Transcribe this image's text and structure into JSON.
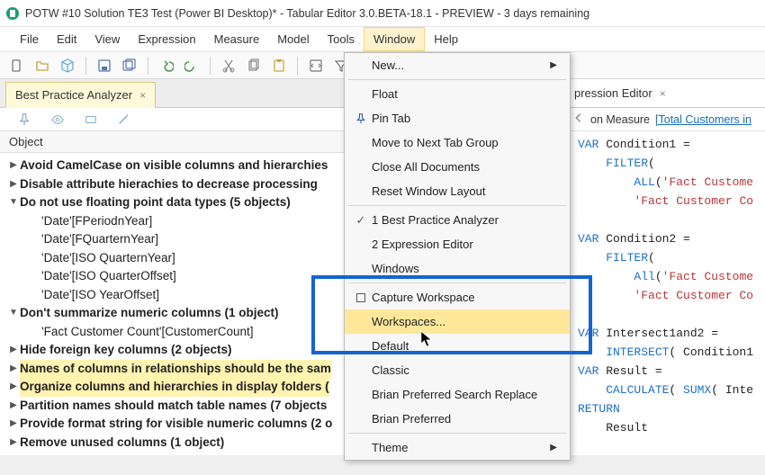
{
  "title": "POTW #10 Solution TE3 Test (Power BI Desktop)* - Tabular Editor 3.0.BETA-18.1 - PREVIEW - 3 days remaining",
  "menubar": [
    "File",
    "Edit",
    "View",
    "Expression",
    "Measure",
    "Model",
    "Tools",
    "Window",
    "Help"
  ],
  "active_menu_index": 7,
  "tab": {
    "label": "Best Practice Analyzer",
    "close": "×"
  },
  "right_tab": {
    "label": "pression Editor",
    "close": "×"
  },
  "column_header": "Object",
  "breadcrumb": {
    "prefix": "on Measure",
    "link": "[Total Customers in"
  },
  "dropdown": {
    "new": "New...",
    "float": "Float",
    "pin": "Pin Tab",
    "move_next": "Move to Next Tab Group",
    "close_all": "Close All Documents",
    "reset": "Reset Window Layout",
    "win1": "1 Best Practice Analyzer",
    "win2": "2 Expression Editor",
    "windows": "Windows",
    "capture": "Capture Workspace",
    "workspaces": "Workspaces...",
    "default": "Default",
    "classic": "Classic",
    "brian1": "Brian Preferred Search Replace",
    "brian2": "Brian  Preferred",
    "theme": "Theme"
  },
  "bpa": [
    {
      "kind": "group",
      "caret": "▶",
      "bold": true,
      "text": "Avoid CamelCase on visible columns and hierarchies"
    },
    {
      "kind": "group",
      "caret": "▶",
      "bold": true,
      "text": "Disable attribute hierachies to decrease processing"
    },
    {
      "kind": "group",
      "caret": "▼",
      "bold": true,
      "text": "Do not use floating point data types (5 objects)"
    },
    {
      "kind": "child",
      "text": "'Date'[FPeriodnYear]"
    },
    {
      "kind": "child",
      "text": "'Date'[FQuarternYear]"
    },
    {
      "kind": "child",
      "text": "'Date'[ISO QuarternYear]"
    },
    {
      "kind": "child",
      "text": "'Date'[ISO QuarterOffset]"
    },
    {
      "kind": "child",
      "text": "'Date'[ISO YearOffset]"
    },
    {
      "kind": "group",
      "caret": "▼",
      "bold": true,
      "text": "Don't summarize numeric columns (1 object)"
    },
    {
      "kind": "child",
      "text": "'Fact Customer Count'[CustomerCount]"
    },
    {
      "kind": "group",
      "caret": "▶",
      "bold": true,
      "text": "Hide foreign key columns (2 objects)"
    },
    {
      "kind": "group",
      "caret": "▶",
      "bold": true,
      "hl": true,
      "text": "Names of columns in relationships should be the sam"
    },
    {
      "kind": "group",
      "caret": "▶",
      "bold": true,
      "hl": true,
      "text": "Organize columns and hierarchies in display folders ("
    },
    {
      "kind": "group",
      "caret": "▶",
      "bold": true,
      "text": "Partition names should match table names (7 objects"
    },
    {
      "kind": "group",
      "caret": "▶",
      "bold": true,
      "text": "Provide format string for visible numeric columns (2 o"
    },
    {
      "kind": "group",
      "caret": "▶",
      "bold": true,
      "text": "Remove unused columns (1 object)"
    }
  ],
  "code": {
    "l1a": "VAR",
    "l1b": " Condition1 =",
    "l2a": "    FILTER",
    "l2b": "(",
    "l3a": "        ALL",
    "l3b": "(",
    "l3c": "'Fact Custome",
    "l4a": "        ",
    "l4b": "'Fact Customer Co",
    "l5": "",
    "l6a": "VAR",
    "l6b": " Condition2 =",
    "l7a": "    FILTER",
    "l7b": "(",
    "l8a": "        All",
    "l8b": "(",
    "l8c": "'Fact Custome",
    "l9a": "        ",
    "l9b": "'Fact Customer Co",
    "l10": "",
    "l11a": "VAR",
    "l11b": " Intersect1and2 =",
    "l12a": "    INTERSECT",
    "l12b": "( Condition1",
    "l13a": "VAR",
    "l13b": " Result =",
    "l14a": "    CALCULATE",
    "l14b": "( ",
    "l14c": "SUMX",
    "l14d": "( Inte",
    "l15a": "RETURN",
    "l16": "    Result"
  }
}
